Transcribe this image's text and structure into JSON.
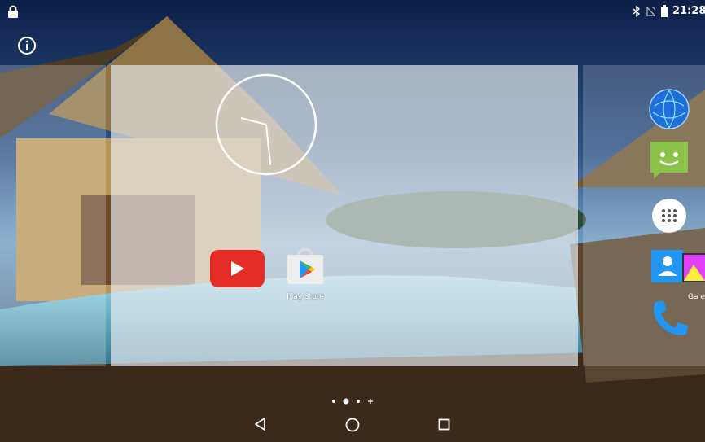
{
  "status_bar": {
    "time": "21:28",
    "icons": [
      "lock-icon",
      "bluetooth-icon",
      "no-sim-icon",
      "battery-icon"
    ]
  },
  "info_icon": "info-icon",
  "clock_widget": {
    "hour": 9,
    "minute": 29
  },
  "apps": {
    "youtube": {
      "icon": "youtube-icon",
      "label": ""
    },
    "play_store": {
      "icon": "play-store-icon",
      "label": "Play Store"
    }
  },
  "dock": {
    "browser": {
      "icon": "globe-icon"
    },
    "messaging": {
      "icon": "messaging-icon"
    },
    "all_apps": {
      "icon": "app-drawer-icon"
    },
    "gallery_folder": {
      "icon": "contacts-gallery-folder-icon",
      "label": "Ga e"
    },
    "phone": {
      "icon": "phone-icon"
    }
  },
  "page_indicator": {
    "pages": 3,
    "current": 2,
    "has_add": true
  },
  "navigation": [
    "back-icon",
    "home-icon",
    "recents-icon"
  ],
  "colors": {
    "accent_youtube": "#e52d27",
    "messaging": "#8bc34a",
    "browser": "#1e6fd9",
    "phone": "#2196f3"
  }
}
